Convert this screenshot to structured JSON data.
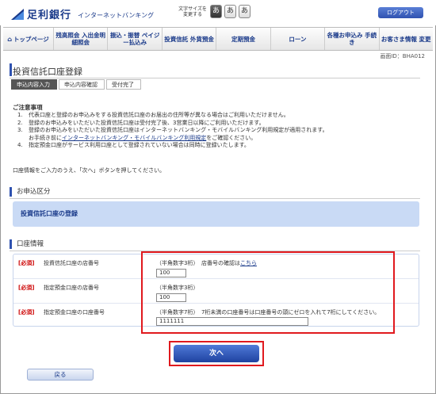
{
  "header": {
    "bank_name": "足利銀行",
    "service_name": "インターネットバンキング",
    "font_size_label": "文字サイズを変更する",
    "font_size_options": [
      "あ",
      "あ",
      "あ"
    ],
    "logout_label": "ログアウト"
  },
  "nav": {
    "items": [
      {
        "label": "トップページ",
        "icon": "house-icon"
      },
      {
        "label": "残高照会 入出金明細照会"
      },
      {
        "label": "振込・振替 ペイジー払込み"
      },
      {
        "label": "投資信託 外貨預金"
      },
      {
        "label": "定期預金"
      },
      {
        "label": "ローン"
      },
      {
        "label": "各種お申込み 手続き"
      },
      {
        "label": "お客さま情報 変更"
      }
    ]
  },
  "screen_id": "画面ID：BHA012",
  "page_title": "投資信託口座登録",
  "steps": [
    "申込内容入力",
    "申込内容確認",
    "受付完了"
  ],
  "notes": {
    "title": "ご注意事項",
    "items": [
      {
        "num": "1.",
        "text": "代表口座と登録のお申込みをする投資信託口座のお届出の住所等が異なる場合はご利用いただけません。"
      },
      {
        "num": "2.",
        "text": "登録のお申込みをいただいた投資信託口座は受付完了後、3営業日以降にご利用いただけます。"
      },
      {
        "num": "3.",
        "text": "登録のお申込みをいただいた投資信託口座はインターネットバンキング・モバイルバンキング利用規定が適用されます。"
      },
      {
        "num": "",
        "text_pre": "お手続き前に",
        "link": "インターネットバンキング・モバイルバンキング利用規定",
        "text_post": "をご確認ください。"
      },
      {
        "num": "4.",
        "text": "指定預金口座がサービス利用口座として登録されていない場合は同時に登録いたします。"
      }
    ]
  },
  "instruction": "口座情報をご入力のうえ、「次へ」ボタンを押してください。",
  "section_apply": {
    "title": "お申込区分",
    "value": "投資信託口座の登録"
  },
  "section_account": {
    "title": "口座情報",
    "rows": [
      {
        "required": "[必須]",
        "label": "投資信託口座の店番号",
        "hint": "（半角数字3桁）　店番号の確認は",
        "link": "こちら",
        "value": "100"
      },
      {
        "required": "[必須]",
        "label": "指定預金口座の店番号",
        "hint": "（半角数字3桁）",
        "value": "100"
      },
      {
        "required": "[必須]",
        "label": "指定預金口座の口座番号",
        "hint": "（半角数字7桁）　7桁未満の口座番号は口座番号の頭にゼロを入れて7桁にしてください。",
        "value": "1111111"
      }
    ]
  },
  "buttons": {
    "next": "次へ",
    "back": "戻る"
  },
  "colors": {
    "accent": "#2f52b0",
    "highlight": "#e0191e",
    "section_box": "#c9daf5",
    "required": "#cc0000"
  }
}
